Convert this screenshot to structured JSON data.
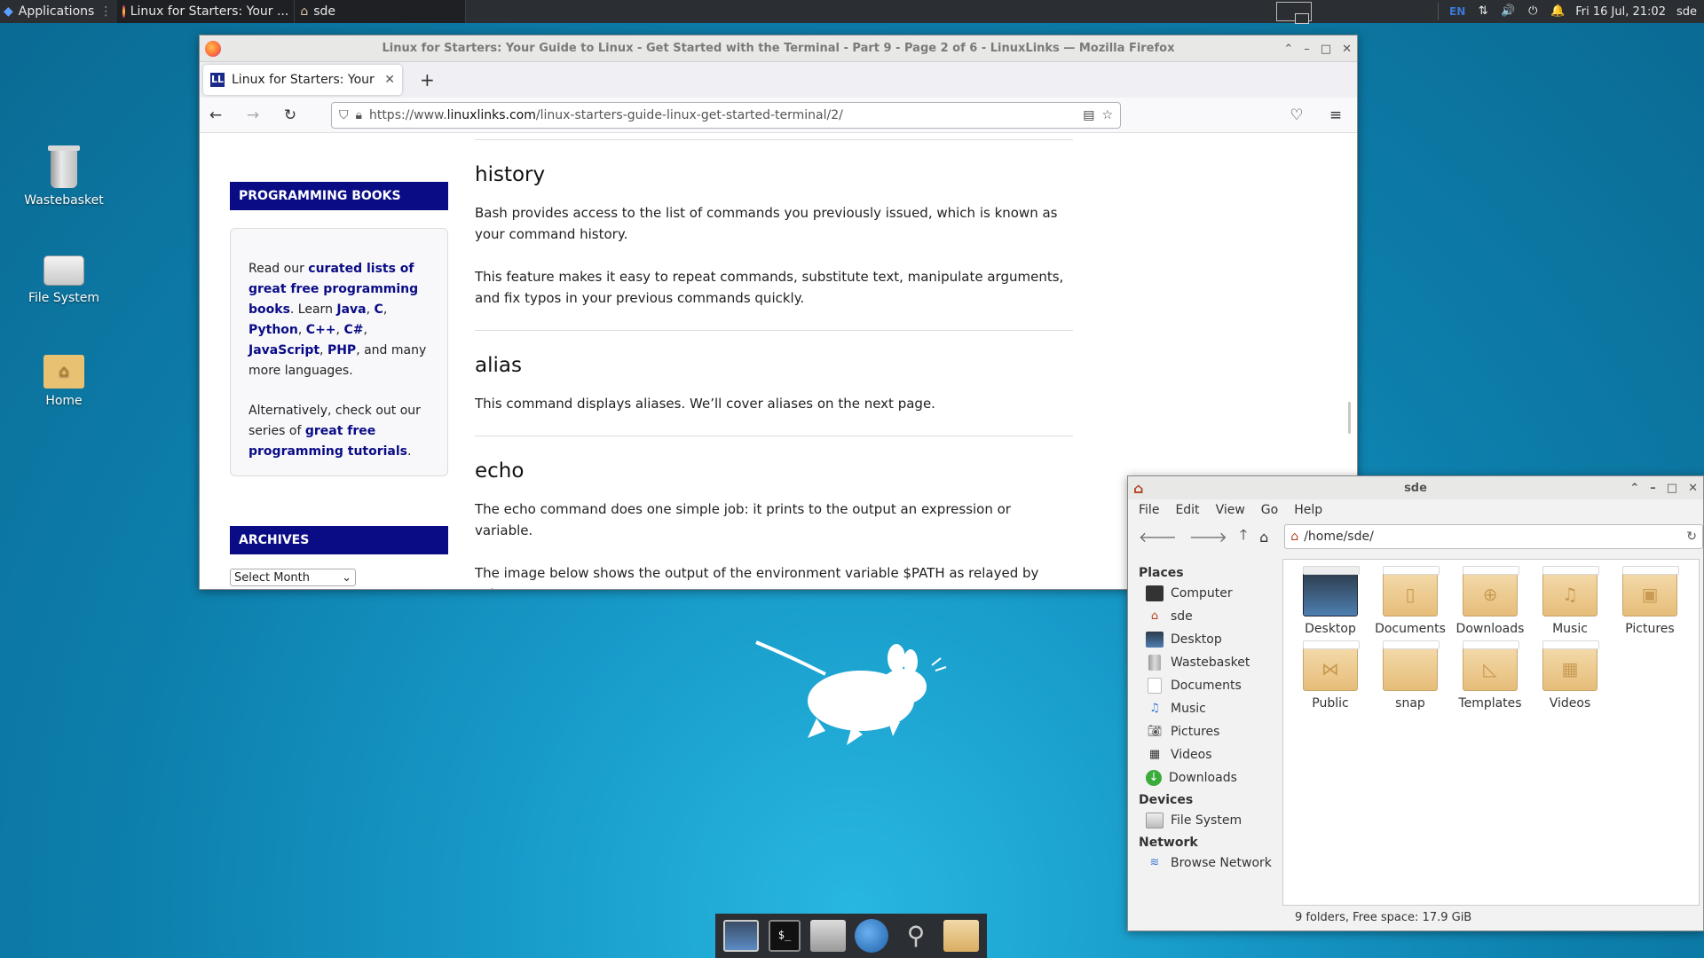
{
  "top_panel": {
    "applications_label": "Applications",
    "task_firefox": "Linux for Starters: Your ...",
    "task_files": "sde",
    "lang": "EN",
    "datetime": "Fri 16 Jul, 21:02",
    "user": "sde"
  },
  "desktop_icons": {
    "wastebasket": "Wastebasket",
    "filesystem": "File System",
    "home": "Home"
  },
  "firefox": {
    "window_title": "Linux for Starters: Your Guide to Linux - Get Started with the Terminal - Part 9 - Page 2 of 6 - LinuxLinks — Mozilla Firefox",
    "tab_label": "Linux for Starters: Your G",
    "favicon": "LL",
    "url_prefix": "https://www.",
    "url_domain": "linuxlinks.com",
    "url_path": "/linux-starters-guide-linux-get-started-terminal/2/",
    "sidebar": {
      "programming_heading": "PROGRAMMING BOOKS",
      "box_read_our": "Read our ",
      "box_link1": "curated lists of great free programming books",
      "box_learn": ". Learn ",
      "lang_java": "Java",
      "lang_c": "C",
      "lang_python": "Python",
      "lang_cpp": "C++",
      "lang_csharp": "C#",
      "lang_js": "JavaScript",
      "lang_php": "PHP",
      "box_more": ", and many more languages.",
      "box_alt": "Alternatively, check out our series of ",
      "box_link2": "great free programming tutorials",
      "archives_heading": "ARCHIVES",
      "select_value": "Select Month"
    },
    "article": {
      "h_history": "history",
      "p_history_1": "Bash provides access to the list of commands you previously issued, which is known as your command history.",
      "p_history_2": "This feature makes it easy to repeat commands, substitute text, manipulate arguments, and fix typos in your previous commands quickly.",
      "h_alias": "alias",
      "p_alias": "This command displays aliases. We’ll cover aliases on the next page.",
      "h_echo": "echo",
      "p_echo_1": "The echo command does one simple job: it prints to the output an expression or variable.",
      "p_echo_2": "The image below shows the output of the environment variable $PATH as relayed by echo."
    }
  },
  "thunar": {
    "title": "sde",
    "menu": [
      "File",
      "Edit",
      "View",
      "Go",
      "Help"
    ],
    "path": "/home/sde/",
    "places_heading": "Places",
    "places": [
      "Computer",
      "sde",
      "Desktop",
      "Wastebasket",
      "Documents",
      "Music",
      "Pictures",
      "Videos",
      "Downloads"
    ],
    "devices_heading": "Devices",
    "devices": [
      "File System"
    ],
    "network_heading": "Network",
    "network": [
      "Browse Network"
    ],
    "folders": [
      "Desktop",
      "Documents",
      "Downloads",
      "Music",
      "Pictures",
      "Public",
      "snap",
      "Templates",
      "Videos"
    ],
    "status": "9 folders, Free space: 17.9 GiB"
  },
  "colors": {
    "sidebar_heading_bg": "#0a0c86",
    "link": "#0a0c86",
    "desktop_bg": "#1799c8",
    "panel_bg": "#2b2e33"
  }
}
